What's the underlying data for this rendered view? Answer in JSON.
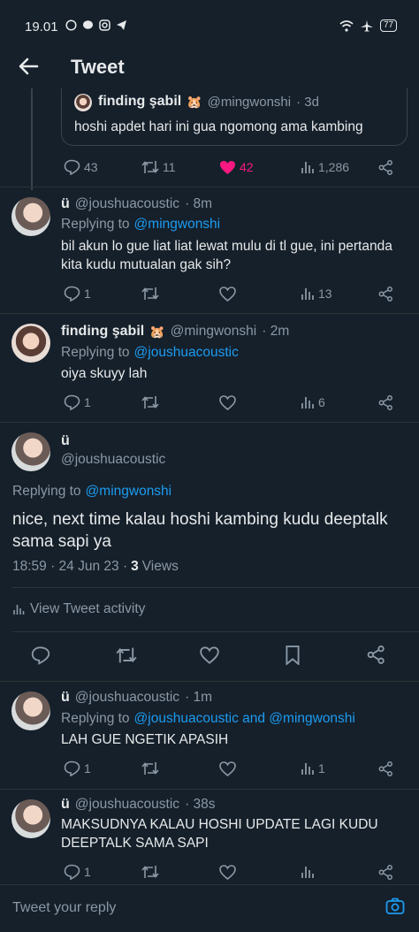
{
  "status_bar": {
    "time": "19.01",
    "battery": "77"
  },
  "header": {
    "title": "Tweet"
  },
  "quoted": {
    "name": "finding şabil",
    "emoji": "🐹",
    "handle": "@mingwonshi",
    "time": "· 3d",
    "text": "hoshi apdet hari ini gua ngomong ama kambing"
  },
  "parent_actions": {
    "replies": "43",
    "retweets": "11",
    "likes": "42",
    "views": "1,286"
  },
  "reply1": {
    "name": "ü",
    "handle": "@joushuacoustic",
    "time": "· 8m",
    "replying_prefix": "Replying to",
    "replying_to": "@mingwonshi",
    "text_line1": "bil akun lo gue liat liat lewat mulu di tl gue, ini pertanda",
    "text_line2": "kita kudu mutualan gak sih?",
    "replies": "1",
    "views": "13"
  },
  "reply2": {
    "name": "finding şabil",
    "emoji": "🐹",
    "handle": "@mingwonshi",
    "time": "· 2m",
    "replying_prefix": "Replying to",
    "replying_to": "@joushuacoustic",
    "text": "oiya skuyy lah",
    "replies": "1",
    "views": "6"
  },
  "main_tweet": {
    "name": "ü",
    "handle": "@joushuacoustic",
    "replying_prefix": "Replying to",
    "replying_to": "@mingwonshi",
    "text_line1": "nice, next time kalau hoshi kambing kudu deeptalk",
    "text_line2": "sama sapi ya",
    "timestamp": "18:59 · 24 Jun 23 ·",
    "views_count": "3",
    "views_label": "Views",
    "activity_label": "View Tweet activity"
  },
  "reply3": {
    "name": "ü",
    "handle": "@joushuacoustic",
    "time": "· 1m",
    "replying_prefix": "Replying to",
    "replying_to": "@joushuacoustic and @mingwonshi",
    "text": "LAH GUE NGETIK APASIH",
    "replies": "1",
    "views": "1"
  },
  "reply4": {
    "name": "ü",
    "handle": "@joushuacoustic",
    "time": "· 38s",
    "text_line1": "MAKSUDNYA KALAU HOSHI UPDATE LAGI KUDU",
    "text_line2": "DEEPTALK SAMA SAPI",
    "replies": "1"
  },
  "reply_bar": {
    "placeholder": "Tweet your reply"
  },
  "colors": {
    "background": "#15202b",
    "link": "#1d9bf0",
    "like": "#f91880",
    "muted": "#8b98a5"
  }
}
